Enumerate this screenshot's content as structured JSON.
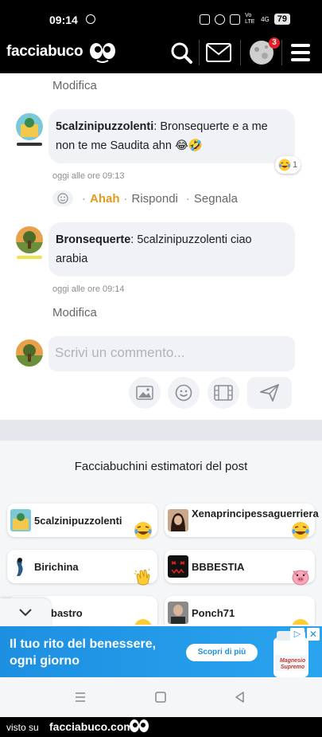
{
  "statusbar": {
    "time": "09:14",
    "network": "Vo LTE",
    "signal_label": "4G",
    "battery": "79"
  },
  "header": {
    "logo": "facciabuco",
    "notification_count": "3"
  },
  "thread": {
    "top_action": "Modifica",
    "comments": [
      {
        "author": "5calzinipuzzolenti",
        "separator": ": ",
        "text": "Bronsequerte e a me non te me Saudita ahn 😂🤣",
        "time": "oggi alle ore 09:13",
        "reaction_count": "1",
        "actions": {
          "ahah": "Ahah",
          "reply": "Rispondi",
          "report": "Segnala"
        }
      },
      {
        "author": "Bronsequerte",
        "separator": ": ",
        "text": "5calzinipuzzolenti ciao arabia",
        "time": "oggi alle ore 09:14",
        "action": "Modifica"
      }
    ],
    "input_placeholder": "Scrivi un commento..."
  },
  "estimators": {
    "title": "Facciabuchini estimatori del post",
    "people": [
      {
        "name": "5calzinipuzzolenti",
        "reaction": "laughing"
      },
      {
        "name": "Xenaprincipessaguerriera",
        "reaction": "laughing"
      },
      {
        "name": "Birichina",
        "reaction": "clapping"
      },
      {
        "name": "BBBESTIA",
        "reaction": "pig"
      },
      {
        "name": "bastro",
        "reaction": "laughing"
      },
      {
        "name": "Ponch71",
        "reaction": "laughing"
      }
    ]
  },
  "ad": {
    "headline": "Il tuo rito del benessere, ogni giorno",
    "cta": "Scopri di più",
    "product_label": "Magnesio Supremo"
  },
  "footer": {
    "seen_on": "visto su",
    "site": "facciabuco.com"
  },
  "colors": {
    "ahah": "#e09b1a",
    "bubble": "#f0f2f5",
    "ad_blue": "#1d8fe1",
    "badge_red": "#e41e26"
  }
}
